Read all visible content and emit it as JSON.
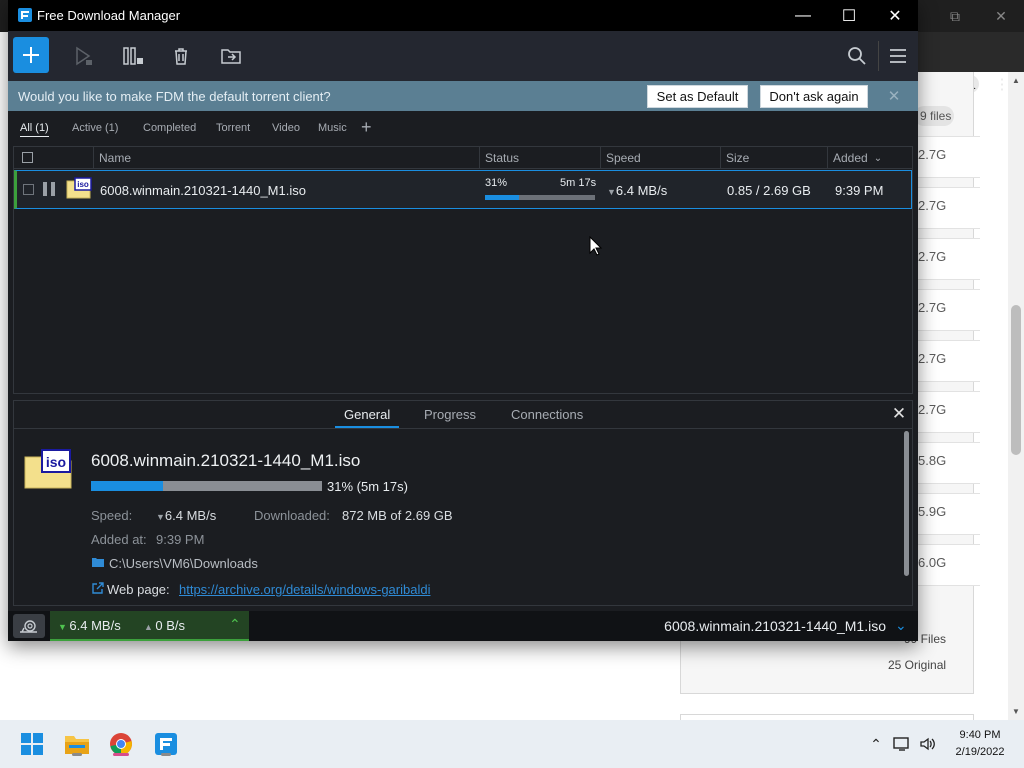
{
  "window": {
    "title": "Free Download Manager",
    "controls": {
      "minimize": "—",
      "maximize": "☐",
      "close": "✕"
    }
  },
  "toolbar": {
    "icons": [
      "add-download-icon",
      "resume-icon",
      "pause-all-icon",
      "delete-icon",
      "move-folder-icon",
      "search-icon",
      "menu-icon"
    ]
  },
  "notification": {
    "message": "Would you like to make FDM the default torrent client?",
    "set_default": "Set as Default",
    "dont_ask": "Don't ask again",
    "close": "✕"
  },
  "filters": {
    "tabs": [
      "All (1)",
      "Active (1)",
      "Completed",
      "Torrent",
      "Video",
      "Music"
    ],
    "active_tab": "All (1)",
    "add": "+"
  },
  "list": {
    "columns": [
      "Name",
      "Status",
      "Speed",
      "Size",
      "Added"
    ],
    "sort_indicator": "⌄",
    "rows": [
      {
        "name": "6008.winmain.210321-1440_M1.iso",
        "status_percent": "31%",
        "status_eta": "5m 17s",
        "progress": 0.31,
        "speed": "6.4 MB/s",
        "size": "0.85 / 2.69 GB",
        "added": "9:39 PM",
        "file_badge": "iso"
      }
    ]
  },
  "details": {
    "tabs": [
      "General",
      "Progress",
      "Connections"
    ],
    "active_tab": "General",
    "close": "✕",
    "file_name": "6008.winmain.210321-1440_M1.iso",
    "progress": 0.31,
    "progress_text": "31% (5m 17s)",
    "speed_label": "Speed:",
    "speed_value": "6.4 MB/s",
    "downloaded_label": "Downloaded:",
    "downloaded_value": "872 MB of 2.69 GB",
    "added_label": "Added at:",
    "added_value": "9:39 PM",
    "folder": "C:\\Users\\VM6\\Downloads",
    "web_page_label": "Web page:",
    "web_page_url": "https://archive.org/details/windows-garibaldi",
    "file_badge": "iso"
  },
  "statusbar": {
    "download_speed": "6.4 MB/s",
    "upload_speed": "0 B/s",
    "current_file": "6008.winmain.210321-1440_M1.iso"
  },
  "background_browser": {
    "files_pill": "9 files",
    "sizes": [
      "2.7G",
      "2.7G",
      "2.7G",
      "2.7G",
      "2.7G",
      "2.7G",
      "5.8G",
      "5.9G",
      "6.0G"
    ],
    "footer_files": "99 Files",
    "footer_original": "25 Original"
  },
  "taskbar": {
    "apps": [
      "windows-start-icon",
      "file-explorer-icon",
      "chrome-icon",
      "fdm-icon"
    ],
    "time": "9:40 PM",
    "date": "2/19/2022"
  },
  "colors": {
    "accent": "#1a8ee0",
    "active_green": "#3ca03c",
    "notification_bg": "#5b7f93",
    "app_bg": "#1b1d21"
  }
}
